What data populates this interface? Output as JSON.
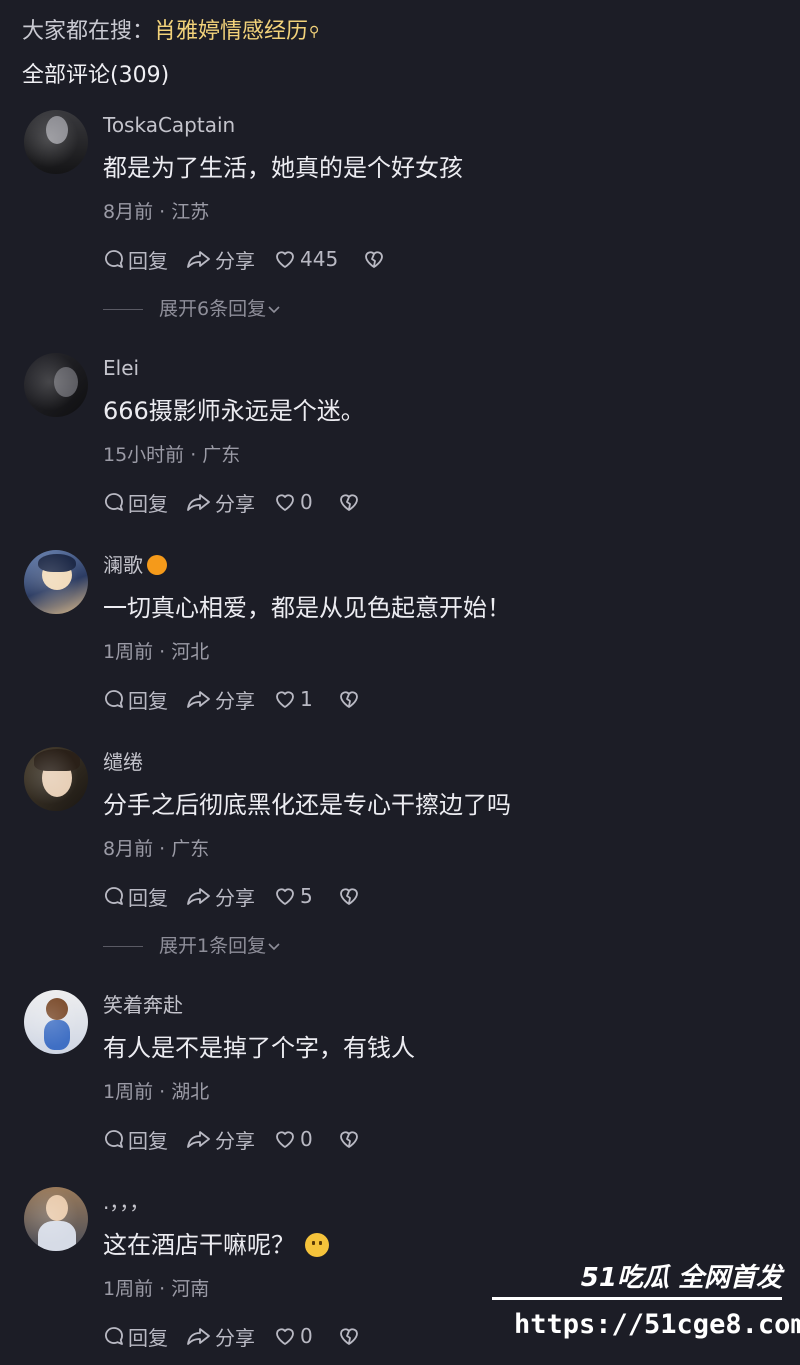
{
  "header": {
    "search_prefix": "大家都在搜：",
    "search_term": "肖雅婷情感经历",
    "comments_title": "全部评论(309)"
  },
  "actions": {
    "reply": "回复",
    "share": "分享"
  },
  "comments": [
    {
      "username": "ToskaCaptain",
      "text": "都是为了生活，她真的是个好女孩",
      "meta": "8月前 · 江苏",
      "likes": "445",
      "expand": "展开6条回复"
    },
    {
      "username": "Elei",
      "text": "666摄影师永远是个迷。",
      "meta": "15小时前 · 广东",
      "likes": "0"
    },
    {
      "username": "澜歌",
      "text": "一切真心相爱，都是从见色起意开始！",
      "meta": "1周前 · 河北",
      "likes": "1"
    },
    {
      "username": "缱绻",
      "text": "分手之后彻底黑化还是专心干擦边了吗",
      "meta": "8月前 · 广东",
      "likes": "5",
      "expand": "展开1条回复"
    },
    {
      "username": "笑着奔赴",
      "text": "有人是不是掉了个字，有钱人",
      "meta": "1周前 · 湖北",
      "likes": "0"
    },
    {
      "username": ".，，，",
      "text": "这在酒店干嘛呢？",
      "meta": "1周前 · 河南",
      "likes": "0"
    }
  ],
  "watermark": {
    "brand": "51吃瓜 全网首发",
    "url": "https://51cge8.com"
  },
  "colors": {
    "background": "#1c1d26",
    "hot_search": "#f2d27a",
    "badge": "#f59a1a"
  }
}
